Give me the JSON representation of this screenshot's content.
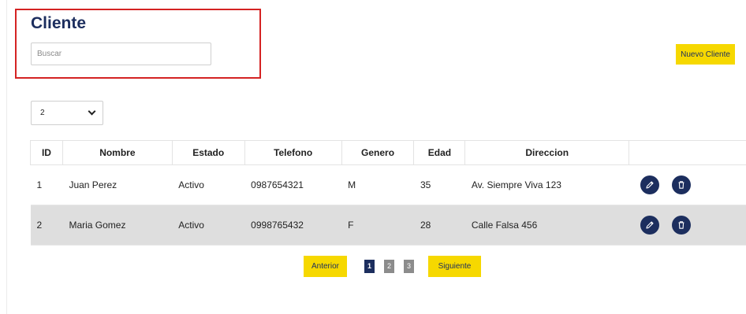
{
  "header": {
    "title": "Cliente",
    "search_placeholder": "Buscar",
    "search_value": "",
    "new_button": "Nuevo Cliente"
  },
  "page_size": {
    "selected": "2"
  },
  "table": {
    "columns": [
      "ID",
      "Nombre",
      "Estado",
      "Telefono",
      "Genero",
      "Edad",
      "Direccion",
      ""
    ],
    "rows": [
      {
        "id": "1",
        "nombre": "Juan Perez",
        "estado": "Activo",
        "telefono": "0987654321",
        "genero": "M",
        "edad": "35",
        "direccion": "Av. Siempre Viva 123"
      },
      {
        "id": "2",
        "nombre": "Maria Gomez",
        "estado": "Activo",
        "telefono": "0998765432",
        "genero": "F",
        "edad": "28",
        "direccion": "Calle Falsa 456"
      }
    ],
    "row_actions": [
      "pencil-icon",
      "trash-icon"
    ]
  },
  "pagination": {
    "prev": "Anterior",
    "next": "Siguiente",
    "pages": [
      "1",
      "2",
      "3"
    ],
    "current": "1"
  },
  "colors": {
    "primary": "#1c2e5e",
    "accent": "#f6d800",
    "highlight": "#d42323",
    "row_stripe": "#dedede"
  }
}
